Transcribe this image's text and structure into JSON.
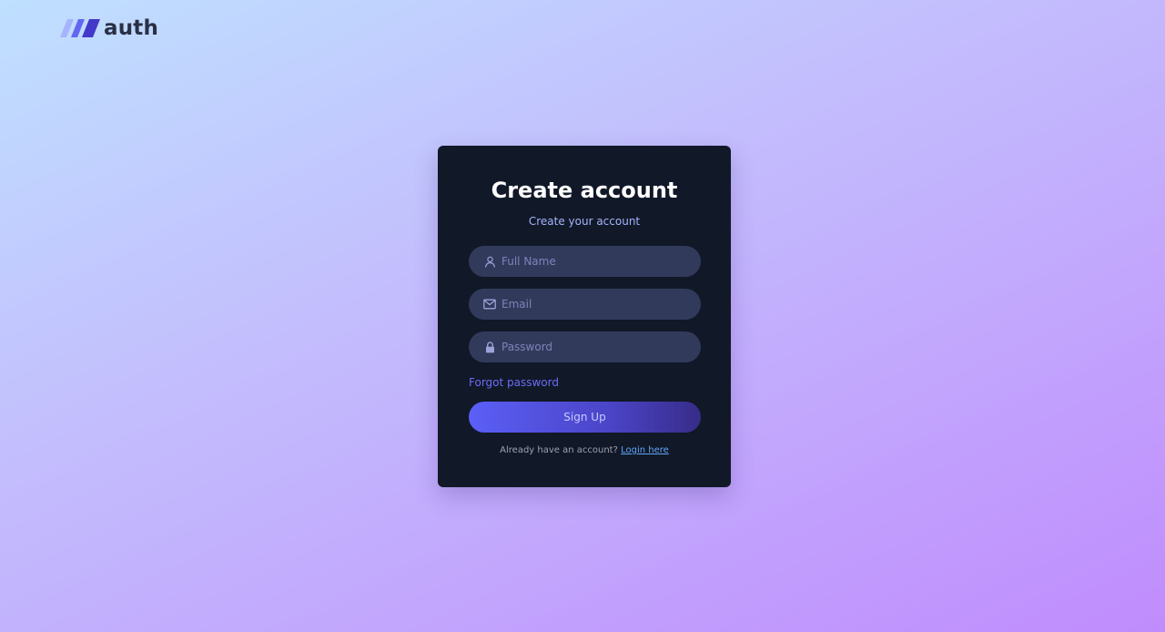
{
  "logo": {
    "text": "auth",
    "colors": [
      "#a5b4fc",
      "#6366f1",
      "#4338ca"
    ]
  },
  "card": {
    "title": "Create account",
    "subtitle": "Create your account"
  },
  "fields": {
    "name": {
      "icon": "user-icon",
      "placeholder": "Full Name",
      "value": ""
    },
    "email": {
      "icon": "mail-icon",
      "placeholder": "Email",
      "value": ""
    },
    "password": {
      "icon": "lock-icon",
      "placeholder": "Password",
      "value": ""
    }
  },
  "forgot_label": "Forgot password",
  "signup_label": "Sign Up",
  "footer": {
    "prompt": "Already have an account?",
    "link": "Login here"
  },
  "colors": {
    "card_bg": "#111827",
    "field_bg": "#323a5c",
    "accent": "#6366f1",
    "link": "#60a5fa"
  }
}
